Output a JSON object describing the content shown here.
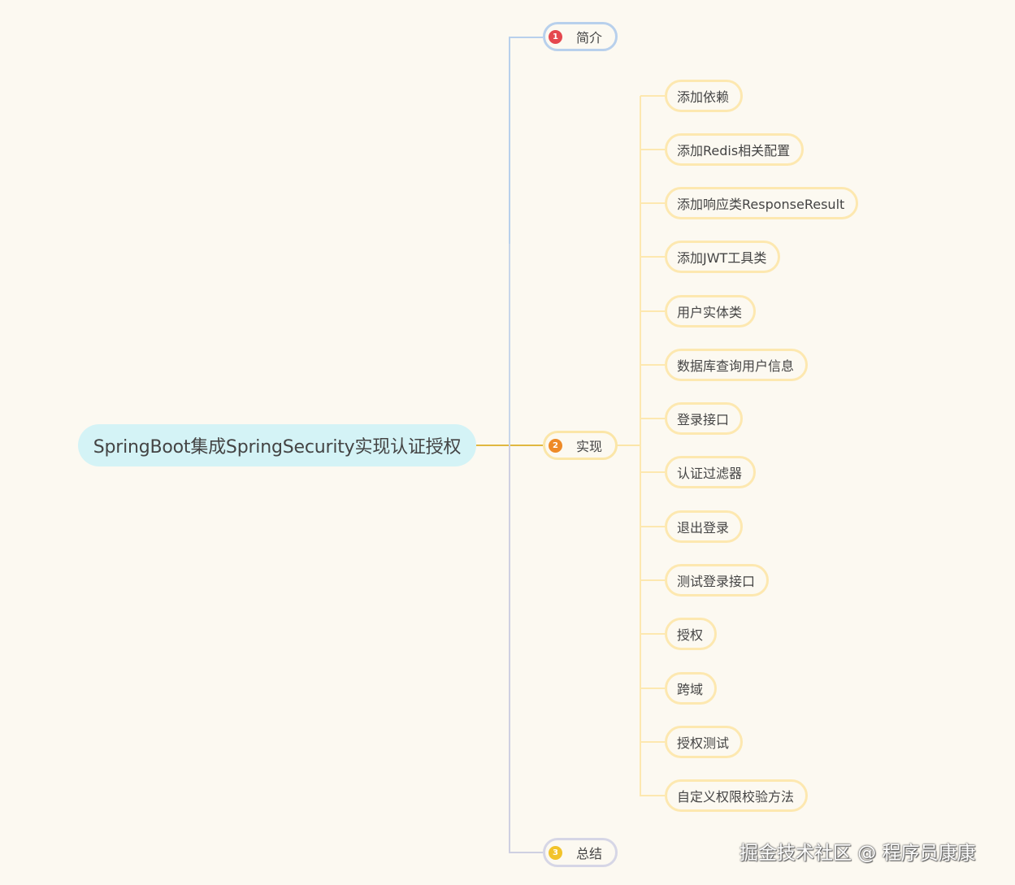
{
  "root": {
    "label": "SpringBoot集成SpringSecurity实现认证授权"
  },
  "branches": [
    {
      "number": "1",
      "label": "简介",
      "color": "#b8d0ec"
    },
    {
      "number": "2",
      "label": "实现",
      "color": "#fbe6a8"
    },
    {
      "number": "3",
      "label": "总结",
      "color": "#d6d6e6"
    }
  ],
  "leaves": [
    "添加依赖",
    "添加Redis相关配置",
    "添加响应类ResponseResult",
    "添加JWT工具类",
    "用户实体类",
    "数据库查询用户信息",
    "登录接口",
    "认证过滤器",
    "退出登录",
    "测试登录接口",
    "授权",
    "跨域",
    "授权测试",
    "自定义权限校验方法"
  ],
  "watermark": "掘金技术社区 @ 程序员康康",
  "colors": {
    "background": "#fcf9f1",
    "root_fill": "#d4f3f6",
    "blue_line": "#b8d0ec",
    "yellow_line": "#fde8b0",
    "gold_line": "#e0b840"
  }
}
